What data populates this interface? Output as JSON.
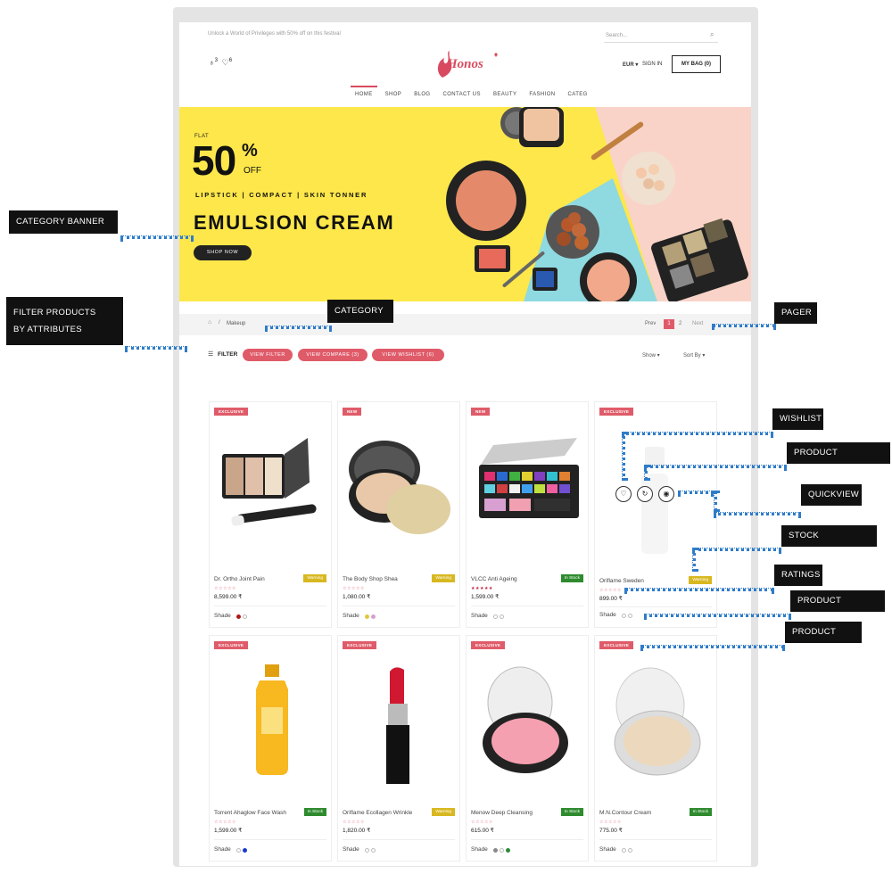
{
  "header": {
    "promo": "Unlock a World of Privileges with 50% off on this festival",
    "search_placeholder": "Search...",
    "compare_count": "3",
    "wishlist_count": "6",
    "logo": "Honos",
    "currency": "EUR",
    "signin": "SIGN IN",
    "bag": "MY BAG (0)"
  },
  "nav": [
    "HOME",
    "SHOP",
    "BLOG",
    "CONTACT US",
    "BEAUTY",
    "FASHION",
    "CATEG"
  ],
  "banner": {
    "flat": "FLAT",
    "number": "50",
    "percent": "%",
    "off": "OFF",
    "subtitle": "LIPSTICK | COMPACT | SKIN TONNER",
    "title": "EMULSION CREAM",
    "cta": "SHOP NOW"
  },
  "breadcrumb": {
    "separator": "/",
    "current": "Makeup"
  },
  "pager": {
    "prev": "Prev",
    "pages": [
      "1",
      "2"
    ],
    "next": "Next"
  },
  "toolbar": {
    "filter": "FILTER",
    "view_filter": "VIEW FILTER",
    "view_compare": "VIEW COMPARE (3)",
    "view_wishlist": "VIEW WISHLIST (6)",
    "show": "Show",
    "sort": "Sort By"
  },
  "products": [
    {
      "badge": "EXCLUSIVE",
      "name": "Dr. Ortho Joint Pain",
      "stock": "Warning",
      "price": "8,599.00 ₹",
      "shade": "Shade"
    },
    {
      "badge": "NEW",
      "name": "The Body Shop Shea",
      "stock": "Warning",
      "price": "1,080.00 ₹",
      "shade": "Shade"
    },
    {
      "badge": "NEW",
      "name": "VLCC Anti Ageing",
      "stock": "In Stock",
      "price": "1,599.00 ₹",
      "shade": "Shade"
    },
    {
      "badge": "EXCLUSIVE",
      "name": "Oriflame Sweden",
      "stock": "Warning",
      "price": "899.00 ₹",
      "shade": "Shade"
    },
    {
      "badge": "EXCLUSIVE",
      "name": "Torrent Ahaglow Face Wash",
      "stock": "In Stock",
      "price": "1,599.00 ₹",
      "shade": "Shade"
    },
    {
      "badge": "EXCLUSIVE",
      "name": "Oriflame Ecollagen Wrinkle",
      "stock": "Warning",
      "price": "1,820.00 ₹",
      "shade": "Shade"
    },
    {
      "badge": "EXCLUSIVE",
      "name": "Menow Deep Cleansing",
      "stock": "In Stock",
      "price": "615.00 ₹",
      "shade": "Shade"
    },
    {
      "badge": "EXCLUSIVE",
      "name": "M.N.Contour Cream",
      "stock": "In Stock",
      "price": "775.00 ₹",
      "shade": "Shade"
    }
  ],
  "callouts": {
    "category_banner": "CATEGORY  BANNER",
    "filter_line1": "FILTER PRODUCTS",
    "filter_line2": "BY ATTRIBUTES",
    "category": "CATEGORY",
    "pager": "PAGER",
    "wishlist": "WISHLIST",
    "comparison": "PRODUCT COMPARISON",
    "quickview": "QUICKVIEW",
    "stock": "STOCK AVAILABILITY",
    "ratings": "RATINGS",
    "attribute": "PRODUCT ATTRIBUTE",
    "label": "PRODUCT LABEL"
  },
  "colors": {
    "accent": "#e05b69",
    "banner": "#fde74a",
    "warning": "#d8b820",
    "instock": "#2e8b2e",
    "callout": "#111111",
    "leader": "#2f7cc8"
  }
}
